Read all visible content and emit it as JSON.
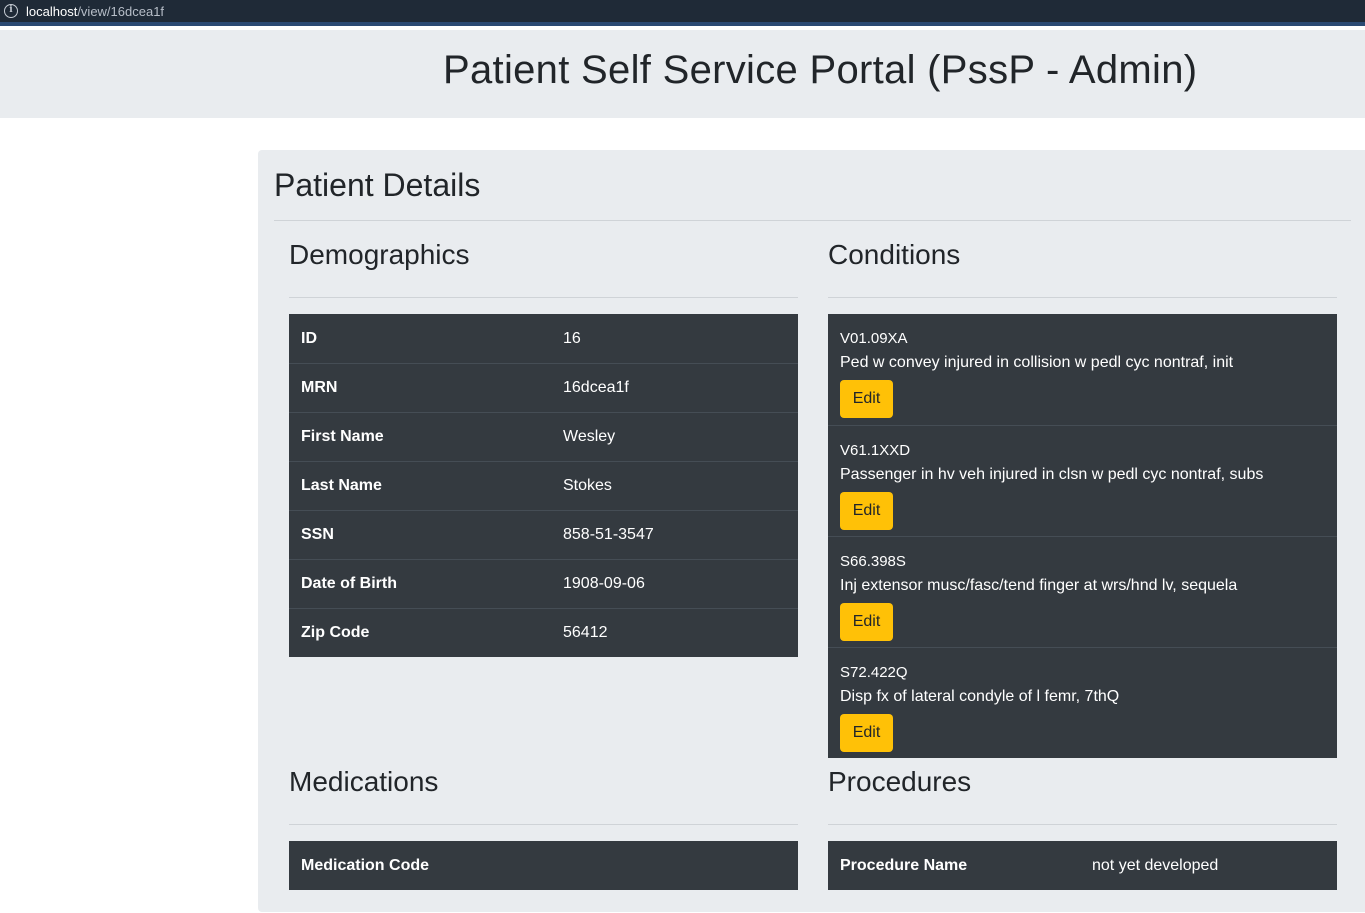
{
  "browser": {
    "url_host": "localhost",
    "url_path": "/view/16dcea1f",
    "info_icon": "info-icon"
  },
  "header": {
    "title": "Patient Self Service Portal (PssP - Admin)"
  },
  "card": {
    "title": "Patient Details"
  },
  "demographics": {
    "title": "Demographics",
    "rows": [
      {
        "label": "ID",
        "value": "16"
      },
      {
        "label": "MRN",
        "value": "16dcea1f"
      },
      {
        "label": "First Name",
        "value": "Wesley"
      },
      {
        "label": "Last Name",
        "value": "Stokes"
      },
      {
        "label": "SSN",
        "value": "858-51-3547"
      },
      {
        "label": "Date of Birth",
        "value": "1908-09-06"
      },
      {
        "label": "Zip Code",
        "value": "56412"
      }
    ]
  },
  "conditions": {
    "title": "Conditions",
    "edit_label": "Edit",
    "items": [
      {
        "code": "V01.09XA",
        "description": "Ped w convey injured in collision w pedl cyc nontraf, init"
      },
      {
        "code": "V61.1XXD",
        "description": "Passenger in hv veh injured in clsn w pedl cyc nontraf, subs"
      },
      {
        "code": "S66.398S",
        "description": "Inj extensor musc/fasc/tend finger at wrs/hnd lv, sequela"
      },
      {
        "code": "S72.422Q",
        "description": "Disp fx of lateral condyle of l femr, 7thQ"
      }
    ]
  },
  "medications": {
    "title": "Medications",
    "header_label": "Medication Code"
  },
  "procedures": {
    "title": "Procedures",
    "header_label": "Procedure Name",
    "header_value": "not yet developed"
  },
  "colors": {
    "accent_button": "#ffc107",
    "table_dark": "#343a40",
    "jumbotron": "#e9ecef"
  }
}
